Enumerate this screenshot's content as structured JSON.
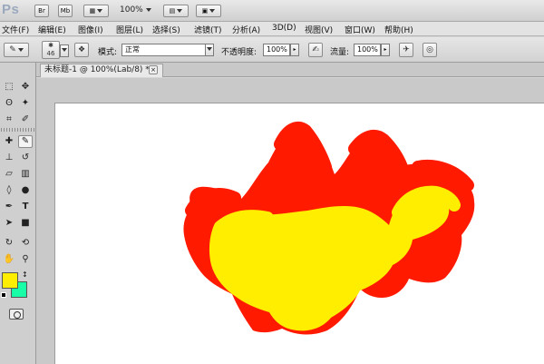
{
  "app": {
    "logo": "Ps"
  },
  "appbar": {
    "bridge_label": "Br",
    "minibridge_label": "Mb",
    "zoom_level": "100%"
  },
  "menu": {
    "items": [
      "文件(F)",
      "编辑(E)",
      "图像(I)",
      "图层(L)",
      "选择(S)",
      "滤镜(T)",
      "分析(A)",
      "3D(D)",
      "视图(V)",
      "窗口(W)",
      "帮助(H)"
    ]
  },
  "options": {
    "brush_size": "46",
    "mode_label": "模式:",
    "mode_value": "正常",
    "opacity_label": "不透明度:",
    "opacity_value": "100%",
    "flow_label": "流量:",
    "flow_value": "100%"
  },
  "document": {
    "tab_title": "未标题-1 @ 100%(Lab/8) *",
    "close_glyph": "×"
  },
  "colors": {
    "foreground": "#ffee00",
    "background": "#19ffa8",
    "paint_red": "#ff1a00",
    "paint_yellow": "#ffee00"
  },
  "tools": {
    "icons": [
      "marquee-icon",
      "move-icon",
      "lasso-icon",
      "magic-wand-icon",
      "crop-icon",
      "eyedropper-icon",
      "healing-icon",
      "brush-icon",
      "stamp-icon",
      "history-brush-icon",
      "eraser-icon",
      "gradient-icon",
      "blur-icon",
      "dodge-icon",
      "pen-icon",
      "type-icon",
      "path-select-icon",
      "shape-icon",
      "3d-rotate-icon",
      "3d-orbit-icon",
      "hand-icon",
      "zoom-icon"
    ]
  }
}
